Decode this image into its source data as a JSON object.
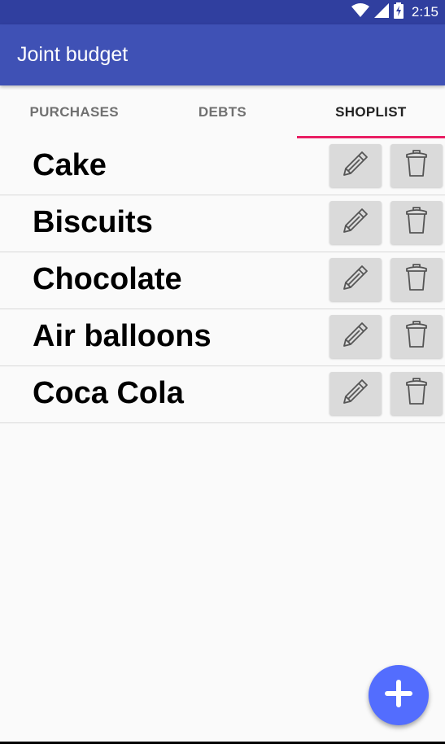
{
  "status_bar": {
    "time": "2:15",
    "icons": [
      "wifi-icon",
      "signal-icon",
      "battery-charging-icon"
    ]
  },
  "app_bar": {
    "title": "Joint budget"
  },
  "tabs": [
    {
      "label": "PURCHASES",
      "active": false
    },
    {
      "label": "DEBTS",
      "active": false
    },
    {
      "label": "SHOPLIST",
      "active": true
    }
  ],
  "shoplist": {
    "items": [
      {
        "name": "Cake"
      },
      {
        "name": "Biscuits"
      },
      {
        "name": "Chocolate"
      },
      {
        "name": "Air balloons"
      },
      {
        "name": "Coca Cola"
      }
    ],
    "row_icons": {
      "edit": "pencil-icon",
      "delete": "trash-icon"
    }
  },
  "fab": {
    "icon": "plus-icon"
  },
  "colors": {
    "status_bar": "#303f9f",
    "app_bar": "#3f51b5",
    "tab_indicator": "#e91e63",
    "fab": "#536dfe",
    "button_bg": "#dadada"
  }
}
